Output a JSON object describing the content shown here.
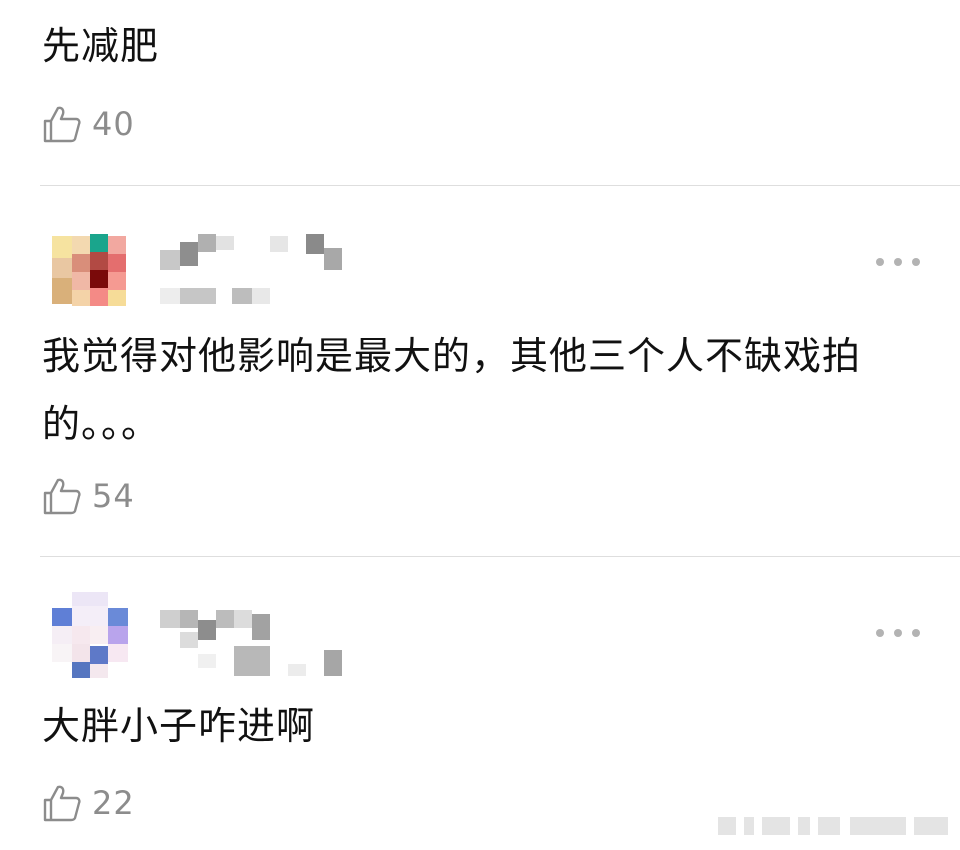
{
  "comments": [
    {
      "text": "先减肥",
      "likes": "40"
    },
    {
      "text": "我觉得对他影响是最大的，其他三个人不缺戏拍的。。。",
      "likes": "54",
      "more": "more-options"
    },
    {
      "text": "大胖小子咋进啊",
      "likes": "22",
      "more": "more-options"
    }
  ],
  "icons": {
    "like": "thumbs-up-icon",
    "more": "more-dots-icon"
  },
  "colors": {
    "like_count": "#8c8c8c",
    "divider": "#dedede",
    "more_dots": "#b3b3b3"
  }
}
